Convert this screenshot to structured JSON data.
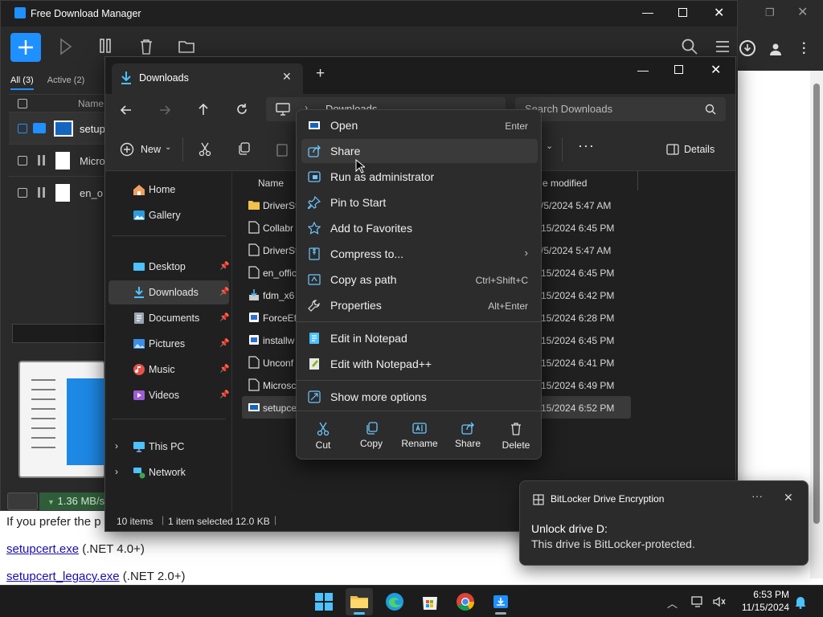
{
  "browser": {
    "prefer_text": "If you prefer the p",
    "link1": "setupcert.exe",
    "link1_suffix": " (.NET 4.0+)",
    "link2": "setupcert_legacy.exe",
    "link2_suffix": " (.NET 2.0+)"
  },
  "fdm": {
    "title": "Free Download Manager",
    "tabs": [
      "All (3)",
      "Active (2)"
    ],
    "col_name": "Name",
    "rows": [
      "setupc",
      "Micro",
      "en_o"
    ],
    "speed": "1.36 MB/s"
  },
  "explorer": {
    "tab_title": "Downloads",
    "breadcrumb": "Downloads",
    "search_placeholder": "Search Downloads",
    "new_label": "New",
    "details_label": "Details",
    "col_name": "Name",
    "col_date": "e modified",
    "sidebar": [
      {
        "label": "Home",
        "icon": "home-icon"
      },
      {
        "label": "Gallery",
        "icon": "gallery-icon"
      },
      {
        "label": "Desktop",
        "icon": "desktop-icon",
        "pinned": true
      },
      {
        "label": "Downloads",
        "icon": "downloads-icon",
        "pinned": true,
        "selected": true
      },
      {
        "label": "Documents",
        "icon": "documents-icon",
        "pinned": true
      },
      {
        "label": "Pictures",
        "icon": "pictures-icon",
        "pinned": true
      },
      {
        "label": "Music",
        "icon": "music-icon",
        "pinned": true
      },
      {
        "label": "Videos",
        "icon": "videos-icon",
        "pinned": true
      },
      {
        "label": "This PC",
        "icon": "this-pc-icon"
      },
      {
        "label": "Network",
        "icon": "network-icon"
      }
    ],
    "files": [
      {
        "name": "DriverSt",
        "date": "/5/2024 5:47 AM",
        "icon": "folder-icon"
      },
      {
        "name": "Collabr",
        "date": "15/2024 6:45 PM",
        "icon": "file-icon"
      },
      {
        "name": "DriverSt",
        "date": "/5/2024 5:47 AM",
        "icon": "file-icon"
      },
      {
        "name": "en_offic",
        "date": "15/2024 6:45 PM",
        "icon": "file-icon"
      },
      {
        "name": "fdm_x6",
        "date": "15/2024 6:42 PM",
        "icon": "installer-icon"
      },
      {
        "name": "ForceEf",
        "date": "15/2024 6:28 PM",
        "icon": "app-icon"
      },
      {
        "name": "installw",
        "date": "15/2024 6:45 PM",
        "icon": "app-icon"
      },
      {
        "name": "Unconf",
        "date": "15/2024 6:41 PM",
        "icon": "file-icon"
      },
      {
        "name": "Microsc",
        "date": "15/2024 6:49 PM",
        "icon": "file-icon"
      },
      {
        "name": "setupce",
        "date": "15/2024 6:52 PM",
        "icon": "exe-icon",
        "selected": true
      }
    ],
    "status": {
      "items": "10 items",
      "selected": "1 item selected",
      "size": "12.0 KB"
    }
  },
  "context_menu": {
    "items": [
      {
        "label": "Open",
        "shortcut": "Enter",
        "icon": "open-icon"
      },
      {
        "label": "Share",
        "shortcut": "",
        "icon": "share-icon"
      },
      {
        "label": "Run as administrator",
        "shortcut": "",
        "icon": "shield-icon"
      },
      {
        "label": "Pin to Start",
        "shortcut": "",
        "icon": "pin-icon"
      },
      {
        "label": "Add to Favorites",
        "shortcut": "",
        "icon": "star-icon"
      },
      {
        "label": "Compress to...",
        "shortcut": "",
        "icon": "compress-icon"
      },
      {
        "label": "Copy as path",
        "shortcut": "Ctrl+Shift+C",
        "icon": "copy-path-icon"
      },
      {
        "label": "Properties",
        "shortcut": "Alt+Enter",
        "icon": "properties-icon"
      },
      {
        "label": "Edit in Notepad",
        "shortcut": "",
        "icon": "notepad-icon"
      },
      {
        "label": "Edit with Notepad++",
        "shortcut": "",
        "icon": "notepadpp-icon"
      },
      {
        "label": "Show more options",
        "shortcut": "",
        "icon": "more-options-icon"
      }
    ],
    "actions": [
      "Cut",
      "Copy",
      "Rename",
      "Share",
      "Delete"
    ]
  },
  "toast": {
    "app": "BitLocker Drive Encryption",
    "title": "Unlock drive D:",
    "body": "This drive is BitLocker-protected."
  },
  "taskbar": {
    "time": "6:53 PM",
    "date": "11/15/2024"
  },
  "colors": {
    "accent": "#4cc2ff",
    "fdm_blue": "#1e90ff",
    "link": "#1a0dab"
  }
}
